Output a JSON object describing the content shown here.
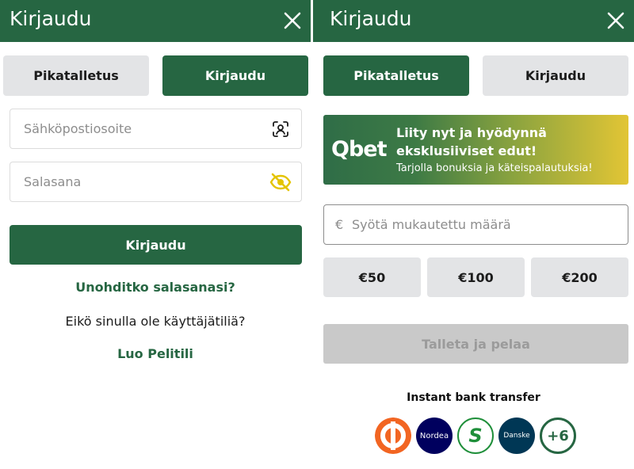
{
  "left": {
    "header_title": "Kirjaudu",
    "tabs": [
      {
        "label": "Pikatalletus",
        "active": false
      },
      {
        "label": "Kirjaudu",
        "active": true
      }
    ],
    "email_placeholder": "Sähköpostiosoite",
    "password_placeholder": "Salasana",
    "login_button": "Kirjaudu",
    "forgot_password_link": "Unohditko salasanasi?",
    "no_account_text": "Eikö sinulla ole käyttäjätiliä?",
    "create_account_link": "Luo Pelitili"
  },
  "right": {
    "header_title": "Kirjaudu",
    "tabs": [
      {
        "label": "Pikatalletus",
        "active": true
      },
      {
        "label": "Kirjaudu",
        "active": false
      }
    ],
    "banner": {
      "logo": "Qbet",
      "title": "Liity nyt ja hyödynnä eksklusiiviset edut!",
      "subtitle": "Tarjolla bonuksia ja käteispalautuksia!"
    },
    "amount_currency": "€",
    "amount_placeholder": "Syötä mukautettu määrä",
    "amount_options": [
      "€50",
      "€100",
      "€200"
    ],
    "deposit_button": "Talleta ja pelaa",
    "bank_title": "Instant bank transfer",
    "banks": [
      {
        "name": "op-logo-icon",
        "color": "#f26522"
      },
      {
        "label": "Nordea",
        "color": "#00005e"
      },
      {
        "label": "S",
        "color": "#1f8f3a"
      },
      {
        "label": "Danske",
        "color": "#003755"
      },
      {
        "label": "+6",
        "color": "#266642"
      }
    ]
  },
  "colors": {
    "brand_green": "#266642",
    "tab_inactive": "#e3e4e6",
    "disabled_button": "#c9c9c9",
    "eye_icon": "#e4c400"
  }
}
